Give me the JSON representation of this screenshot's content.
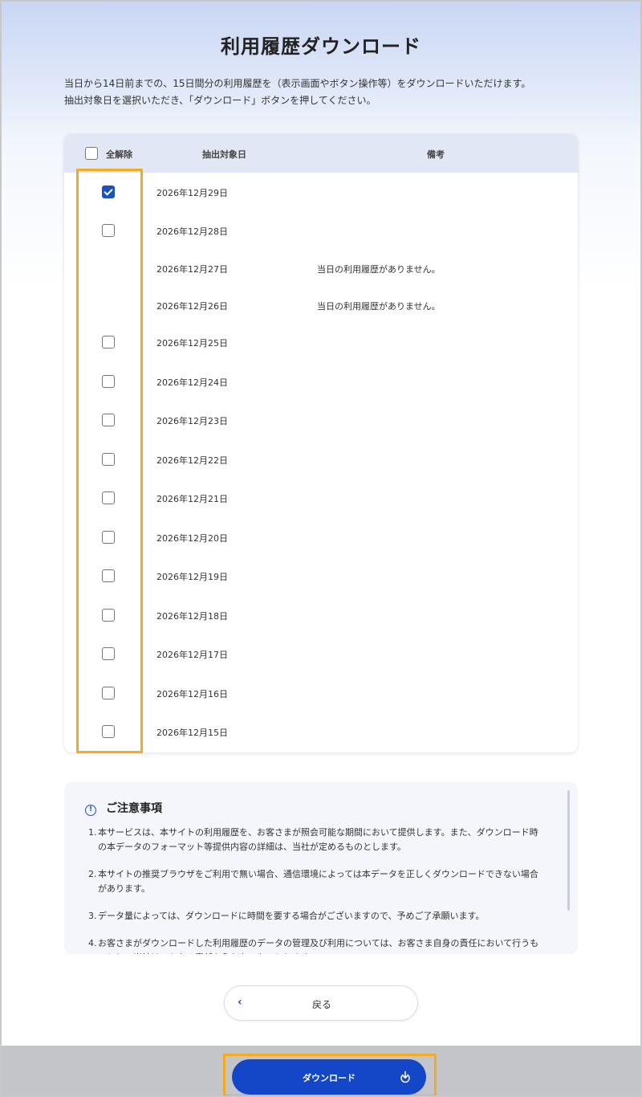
{
  "page": {
    "title": "利用履歴ダウンロード",
    "intro_line1": "当日から14日前までの、15日間分の利用履歴を（表示画面やボタン操作等）をダウンロードいただけます。",
    "intro_line2": "抽出対象日を選択いただき、「ダウンロード」ボタンを押してください。"
  },
  "table": {
    "header": {
      "select_all_label": "全解除",
      "date_label": "抽出対象日",
      "note_label": "備考"
    },
    "rows": [
      {
        "date": "2026年12月29日",
        "has_checkbox": true,
        "checked": true,
        "note": ""
      },
      {
        "date": "2026年12月28日",
        "has_checkbox": true,
        "checked": false,
        "note": ""
      },
      {
        "date": "2026年12月27日",
        "has_checkbox": false,
        "checked": false,
        "note": "当日の利用履歴がありません。"
      },
      {
        "date": "2026年12月26日",
        "has_checkbox": false,
        "checked": false,
        "note": "当日の利用履歴がありません。"
      },
      {
        "date": "2026年12月25日",
        "has_checkbox": true,
        "checked": false,
        "note": ""
      },
      {
        "date": "2026年12月24日",
        "has_checkbox": true,
        "checked": false,
        "note": ""
      },
      {
        "date": "2026年12月23日",
        "has_checkbox": true,
        "checked": false,
        "note": ""
      },
      {
        "date": "2026年12月22日",
        "has_checkbox": true,
        "checked": false,
        "note": ""
      },
      {
        "date": "2026年12月21日",
        "has_checkbox": true,
        "checked": false,
        "note": ""
      },
      {
        "date": "2026年12月20日",
        "has_checkbox": true,
        "checked": false,
        "note": ""
      },
      {
        "date": "2026年12月19日",
        "has_checkbox": true,
        "checked": false,
        "note": ""
      },
      {
        "date": "2026年12月18日",
        "has_checkbox": true,
        "checked": false,
        "note": ""
      },
      {
        "date": "2026年12月17日",
        "has_checkbox": true,
        "checked": false,
        "note": ""
      },
      {
        "date": "2026年12月16日",
        "has_checkbox": true,
        "checked": false,
        "note": ""
      },
      {
        "date": "2026年12月15日",
        "has_checkbox": true,
        "checked": false,
        "note": ""
      }
    ]
  },
  "notes": {
    "icon": "info-icon",
    "title": "ご注意事項",
    "items": [
      {
        "num": "1.",
        "text": "本サービスは、本サイトの利用履歴を、お客さまが照会可能な期間において提供します。また、ダウンロード時の本データのフォーマット等提供内容の詳細は、当社が定めるものとします。"
      },
      {
        "num": "2.",
        "text": "本サイトの推奨ブラウザをご利用で無い場合、通信環境によっては本データを正しくダウンロードできない場合があります。"
      },
      {
        "num": "3.",
        "text": "データ量によっては、ダウンロードに時間を要する場合がございますので、予めご了承願います。"
      },
      {
        "num": "4.",
        "text": "お客さまがダウンロードした利用履歴のデータの管理及び利用については、お客さま自身の責任において行うものとし、当社はいかなる責任も負わないものとします。"
      }
    ]
  },
  "buttons": {
    "back_label": "戻る",
    "back_icon": "chevron-left-icon",
    "download_label": "ダウンロード",
    "download_icon": "download-icon"
  },
  "colors": {
    "accent": "#1447c7",
    "highlight": "#f2ab22",
    "table_header_bg": "#e1e7f5",
    "footer_bg": "#c3c5c9"
  }
}
